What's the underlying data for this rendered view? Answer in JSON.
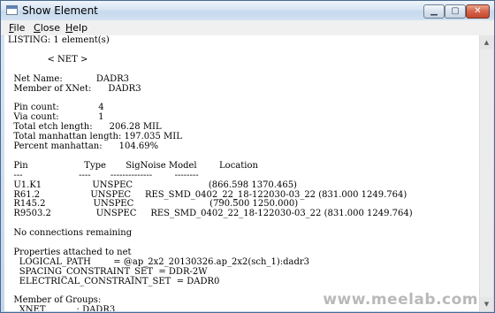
{
  "window": {
    "title": "Show Element"
  },
  "caption_buttons": {
    "minimize": "▁",
    "maximize": "▢",
    "close": "✕"
  },
  "menu": {
    "file": {
      "mnemonic": "F",
      "rest": "ile"
    },
    "close": {
      "mnemonic": "C",
      "rest": "lose"
    },
    "help": {
      "mnemonic": "H",
      "rest": "elp"
    }
  },
  "listing_text": "LISTING: 1 element(s)\n\n              < NET >\n\n  Net Name:            DADR3\n  Member of XNet:      DADR3\n\n  Pin count:              4\n  Via count:              1\n  Total etch length:      206.28 MIL\n  Total manhattan length: 197.035 MIL\n  Percent manhattan:      104.69%\n\n  Pin                    Type       SigNoise Model        Location\n  ---                    ----       --------------        --------\n  U1.K1                  UNSPEC                           (866.598 1370.465)\n  R61.2                  UNSPEC     RES_SMD_0402_22_18-122030-03_22 (831.000 1249.764)\n  R145.2                 UNSPEC                           (790.500 1250.000)\n  R9503.2                UNSPEC     RES_SMD_0402_22_18-122030-03_22 (831.000 1249.764)\n\n  No connections remaining\n\n  Properties attached to net\n    LOGICAL_PATH        = @ap_2x2_20130326.ap_2x2(sch_1):dadr3\n    SPACING_CONSTRAINT_SET  = DDR-2W\n    ELECTRICAL_CONSTRAINT_SET  = DADR0\n\n  Member of Groups:\n    XNET           : DADR3",
  "watermark": "www.meelab.com",
  "scrollbar": {
    "up": "▲",
    "down": "▼"
  }
}
